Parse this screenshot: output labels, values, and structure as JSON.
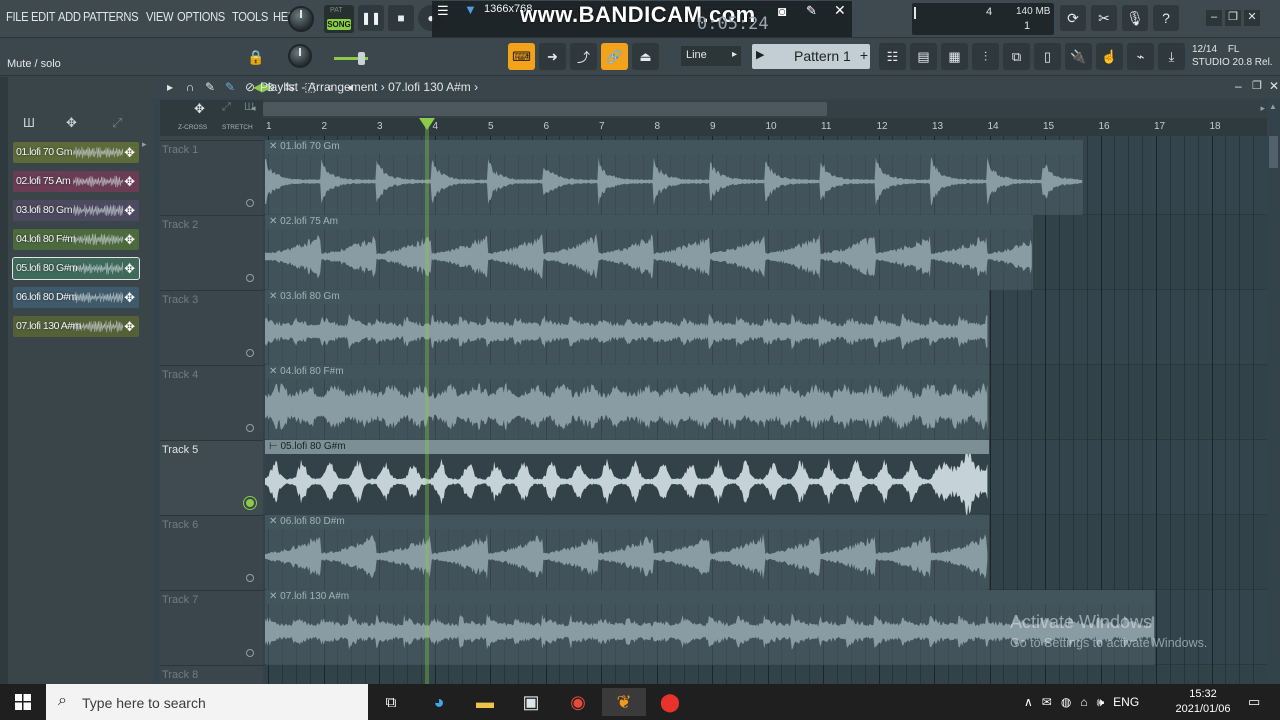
{
  "menu": [
    "FILE",
    "EDIT",
    "ADD",
    "PATTERNS",
    "VIEW",
    "OPTIONS",
    "TOOLS",
    "HELP"
  ],
  "transport": {
    "pat_label": "PAT",
    "song_label": "SONG",
    "time": "0:05:24"
  },
  "recorder": {
    "resolution": "1366x768",
    "watermark": "www.BANDICAM.com"
  },
  "cpu": {
    "polyphony": "4",
    "memory": "140 MB",
    "channels": "1"
  },
  "hint_text": "Mute / solo",
  "snap": "Line",
  "pattern": "Pattern 1",
  "fl": {
    "date": "12/14",
    "brand": "FL",
    "version": "STUDIO 20.8 Rel."
  },
  "playlist": {
    "title": "Playlist - Arrangement",
    "breadcrumb_item": "07.lofi 130 A#m",
    "zcross_label": "Z-CROSS",
    "stretch_label": "STRETCH",
    "bars": [
      "1",
      "2",
      "3",
      "4",
      "5",
      "6",
      "7",
      "8",
      "9",
      "10",
      "11",
      "12",
      "13",
      "14",
      "15",
      "16",
      "17",
      "18"
    ],
    "active_track": 5,
    "playhead_bar": 3.86
  },
  "browser_patterns": [
    {
      "name": "01.lofi 70 Gm",
      "color": "#5d6a3a"
    },
    {
      "name": "02.lofi 75 Am",
      "color": "#6a3d55"
    },
    {
      "name": "03.lofi 80 Gm",
      "color": "#4d4a5f"
    },
    {
      "name": "04.lofi 80 F#m",
      "color": "#4d6a3f"
    },
    {
      "name": "05.lofi 80 G#m",
      "color": "#3f6a5a"
    },
    {
      "name": "06.lofi 80 D#m",
      "color": "#3f5a6a"
    },
    {
      "name": "07.lofi 130 A#m",
      "color": "#546038"
    }
  ],
  "tracks": [
    {
      "name": "Track 1",
      "clip": "01.lofi 70 Gm",
      "end_bar": 15.7,
      "style": "plucks"
    },
    {
      "name": "Track 2",
      "clip": "02.lofi 75 Am",
      "end_bar": 14.8,
      "style": "swells"
    },
    {
      "name": "Track 3",
      "clip": "03.lofi 80 Gm",
      "end_bar": 14.0,
      "style": "chords"
    },
    {
      "name": "Track 4",
      "clip": "04.lofi 80 F#m",
      "end_bar": 14.0,
      "style": "dense"
    },
    {
      "name": "Track 5",
      "clip": "05.lofi 80 G#m",
      "end_bar": 14.0,
      "style": "selected"
    },
    {
      "name": "Track 6",
      "clip": "06.lofi 80 D#m",
      "end_bar": 14.0,
      "style": "swells"
    },
    {
      "name": "Track 7",
      "clip": "07.lofi 130 A#m",
      "end_bar": 17.0,
      "style": "chords"
    },
    {
      "name": "Track 8",
      "clip": "",
      "end_bar": 0,
      "style": "none"
    }
  ],
  "activate": {
    "title": "Activate Windows",
    "subtitle": "Go to Settings to activate Windows."
  },
  "taskbar": {
    "search_placeholder": "Type here to search",
    "language": "ENG",
    "time": "15:32",
    "date": "2021/01/06"
  }
}
